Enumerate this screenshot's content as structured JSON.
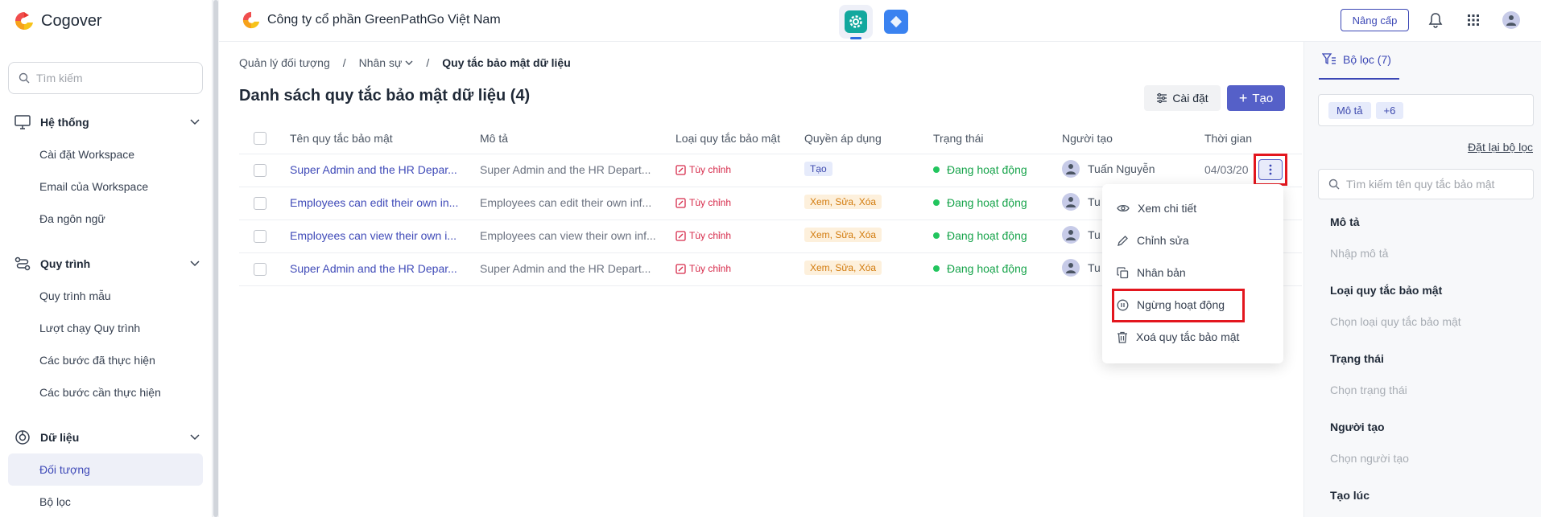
{
  "brand": {
    "name": "Cogover"
  },
  "sidebar": {
    "search_placeholder": "Tìm kiếm",
    "sections": [
      {
        "label": "Hệ thống",
        "items": [
          "Cài đặt Workspace",
          "Email của Workspace",
          "Đa ngôn ngữ"
        ]
      },
      {
        "label": "Quy trình",
        "items": [
          "Quy trình mẫu",
          "Lượt chạy Quy trình",
          "Các bước đã thực hiện",
          "Các bước cần thực hiện"
        ]
      },
      {
        "label": "Dữ liệu",
        "items": [
          "Đối tượng",
          "Bộ lọc"
        ]
      }
    ],
    "active_item": "Đối tượng"
  },
  "topbar": {
    "company": "Công ty cổ phần GreenPathGo Việt Nam",
    "upgrade_label": "Nâng cấp"
  },
  "breadcrumb": [
    "Quản lý đối tượng",
    "/",
    "Nhân sự",
    "/",
    "Quy tắc bảo mật dữ liệu"
  ],
  "page": {
    "title": "Danh sách quy tắc bảo mật dữ liệu (4)",
    "settings_label": "Cài đặt",
    "create_label": "Tạo"
  },
  "table": {
    "columns": [
      "Tên quy tắc bảo mật",
      "Mô tả",
      "Loại quy tắc bảo mật",
      "Quyền áp dụng",
      "Trạng thái",
      "Người tạo",
      "Thời gian"
    ],
    "rows": [
      {
        "name": "Super Admin and the HR Depar...",
        "desc": "Super Admin and the HR Depart...",
        "type": "Tùy chỉnh",
        "perm": "Tạo",
        "status": "Đang hoạt động",
        "creator": "Tuấn Nguyễn",
        "time": "04/03/20"
      },
      {
        "name": "Employees can edit their own in...",
        "desc": "Employees can edit their own inf...",
        "type": "Tùy chỉnh",
        "perm": "Xem, Sửa, Xóa",
        "status": "Đang hoạt động",
        "creator": "Tu",
        "time": ""
      },
      {
        "name": "Employees can view their own i...",
        "desc": "Employees can view their own inf...",
        "type": "Tùy chỉnh",
        "perm": "Xem, Sửa, Xóa",
        "status": "Đang hoạt động",
        "creator": "Tu",
        "time": ""
      },
      {
        "name": "Super Admin and the HR Depar...",
        "desc": "Super Admin and the HR Depart...",
        "type": "Tùy chỉnh",
        "perm": "Xem, Sửa, Xóa",
        "status": "Đang hoạt động",
        "creator": "Tu",
        "time": ""
      }
    ]
  },
  "context_menu": {
    "items": [
      "Xem chi tiết",
      "Chỉnh sửa",
      "Nhân bản",
      "Ngừng hoạt động",
      "Xoá quy tắc bảo mật"
    ]
  },
  "filter": {
    "tab_label": "Bộ lọc (7)",
    "chips": [
      "Mô tả",
      "+6"
    ],
    "reset_label": "Đặt lại bộ lọc",
    "search_placeholder": "Tìm kiếm tên quy tắc bảo mật",
    "fields": [
      {
        "label": "Mô tả",
        "placeholder": "Nhập mô tả"
      },
      {
        "label": "Loại quy tắc bảo mật",
        "placeholder": "Chọn loại quy tắc bảo mật"
      },
      {
        "label": "Trạng thái",
        "placeholder": "Chọn trạng thái"
      },
      {
        "label": "Người tạo",
        "placeholder": "Chọn người tạo"
      },
      {
        "label": "Tạo lúc",
        "placeholder": ""
      }
    ]
  },
  "colors": {
    "accent": "#5560c8",
    "link": "#3f4ab8",
    "status": "#16a34a",
    "danger": "#d62a4a"
  }
}
